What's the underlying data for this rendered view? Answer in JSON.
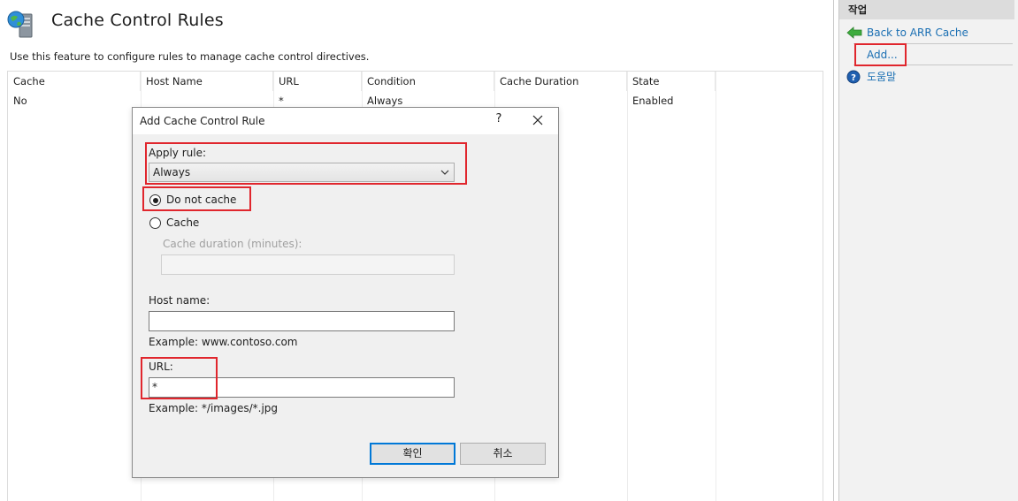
{
  "page": {
    "title": "Cache Control Rules",
    "description": "Use this feature to configure rules to manage cache control directives."
  },
  "table": {
    "columns": [
      "Cache",
      "Host Name",
      "URL",
      "Condition",
      "Cache Duration",
      "State"
    ],
    "rows": [
      {
        "cache": "No",
        "host_name": "",
        "url": "*",
        "condition": "Always",
        "cache_duration": "",
        "state": "Enabled"
      }
    ]
  },
  "actions": {
    "header": "작업",
    "items": [
      {
        "label": "Back to ARR Cache",
        "icon": "back-arrow-icon"
      },
      {
        "label": "Add...",
        "icon": ""
      },
      {
        "label": "도움말",
        "icon": "help-icon"
      }
    ]
  },
  "dialog": {
    "title": "Add Cache Control Rule",
    "help_glyph": "?",
    "apply_rule_label": "Apply rule:",
    "apply_rule_value": "Always",
    "radio_do_not_cache": "Do not cache",
    "radio_cache": "Cache",
    "selected_option": "Do not cache",
    "cache_duration_label": "Cache duration (minutes):",
    "cache_duration_value": "",
    "host_name_label": "Host name:",
    "host_name_value": "",
    "host_name_example": "Example: www.contoso.com",
    "url_label": "URL:",
    "url_value": "*",
    "url_example": "Example: */images/*.jpg",
    "ok_button": "확인",
    "cancel_button": "취소"
  },
  "colors": {
    "highlight": "#e0262d",
    "link": "#1a6fb3",
    "default_button_border": "#0078d7"
  }
}
